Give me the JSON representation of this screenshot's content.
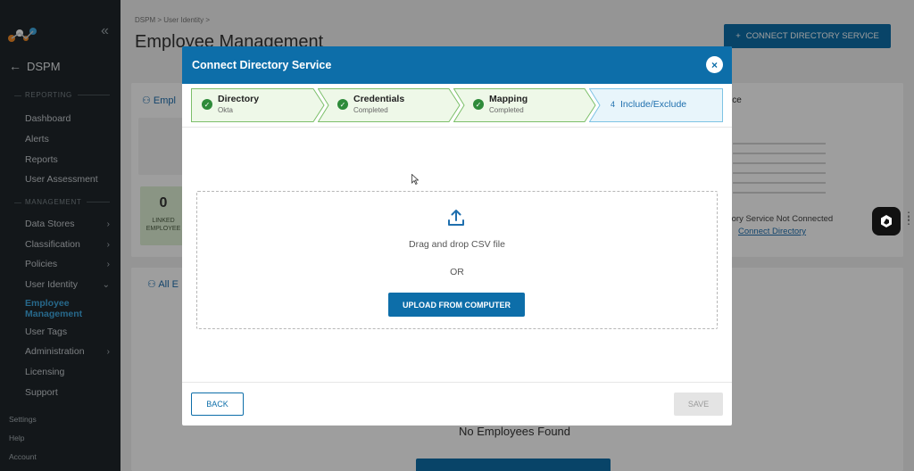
{
  "sidebar": {
    "collapse_icon": "double-chevron-left-icon",
    "app_name": "DSPM",
    "reporting_header": "REPORTING",
    "reporting_items": [
      "Dashboard",
      "Alerts",
      "Reports",
      "User Assessment"
    ],
    "management_header": "MANAGEMENT",
    "management_items": [
      {
        "label": "Data Stores",
        "chevron": ">"
      },
      {
        "label": "Classification",
        "chevron": ">"
      },
      {
        "label": "Policies",
        "chevron": ">"
      },
      {
        "label": "User Identity",
        "chevron": "v"
      }
    ],
    "active_line1": "Employee",
    "active_line2": "Management",
    "after_items": [
      {
        "label": "User Tags",
        "chevron": ""
      },
      {
        "label": "Administration",
        "chevron": ">"
      },
      {
        "label": "Licensing",
        "chevron": ""
      },
      {
        "label": "Support",
        "chevron": ""
      }
    ],
    "bottom_items": [
      "Settings",
      "Help",
      "Account"
    ]
  },
  "page": {
    "breadcrumb": "DSPM > User Identity >",
    "title": "Employee Management",
    "connect_button": "CONNECT DIRECTORY SERVICE",
    "employees_label": "Empl",
    "linked_count": "0",
    "linked_label_1": "LINKED",
    "linked_label_2": "EMPLOYEE",
    "all_employees_label": "All E",
    "right_card_title": "vice",
    "not_connected": "tory Service Not Connected",
    "connect_link": "Connect Directory",
    "no_employees": "No Employees Found"
  },
  "modal": {
    "title": "Connect Directory Service",
    "close_glyph": "×",
    "steps": [
      {
        "title": "Directory",
        "subtitle": "Okta",
        "state": "done"
      },
      {
        "title": "Credentials",
        "subtitle": "Completed",
        "state": "done"
      },
      {
        "title": "Mapping",
        "subtitle": "Completed",
        "state": "done"
      },
      {
        "number": "4",
        "title": "Include/Exclude",
        "state": "active"
      }
    ],
    "drag_text": "Drag and drop CSV file",
    "or_text": "OR",
    "upload_button": "UPLOAD FROM COMPUTER",
    "back_button": "BACK",
    "save_button": "SAVE"
  },
  "colors": {
    "primary": "#0d6ea9",
    "sidebar_bg": "#1f262b",
    "done_bg": "#eef8e8",
    "done_border": "#7cbf6a",
    "active_bg": "#e8f5fb",
    "active_border": "#7ec3e4",
    "check": "#2e8b3a"
  }
}
